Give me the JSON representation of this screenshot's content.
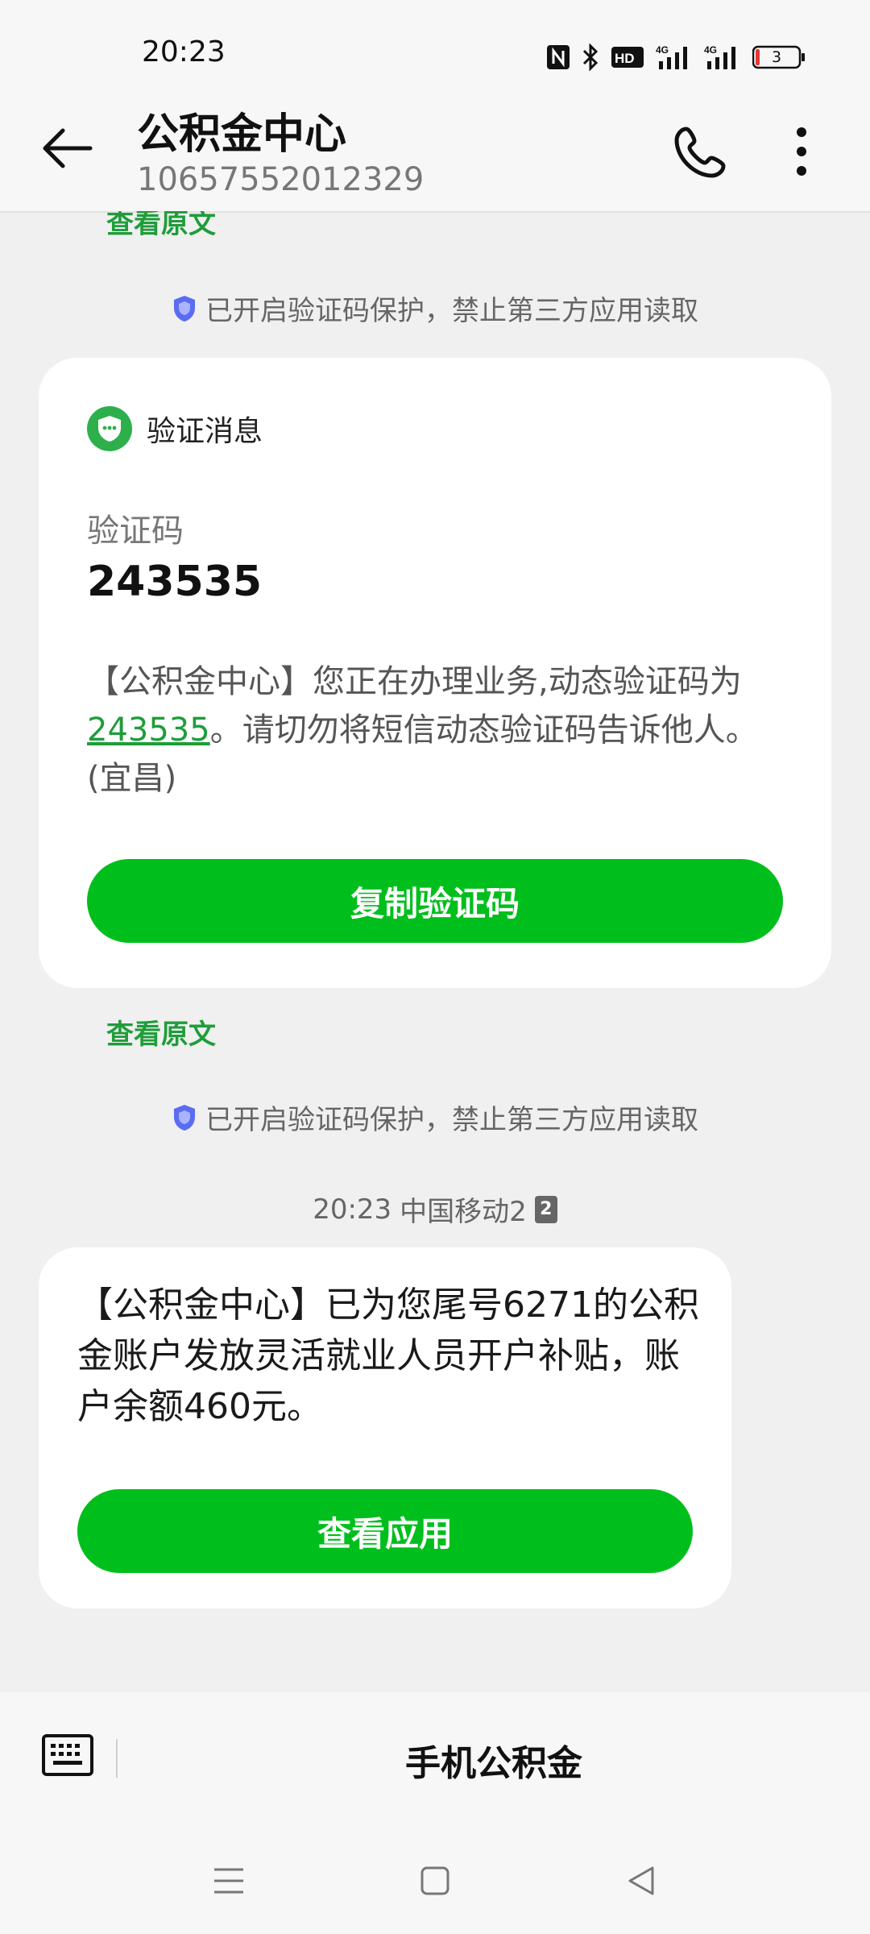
{
  "status_bar": {
    "time": "20:23",
    "battery": "3",
    "icons": [
      "nfc-icon",
      "bluetooth-icon",
      "hd-icon",
      "signal-4g-icon",
      "signal-4g-icon",
      "battery-icon"
    ]
  },
  "header": {
    "title": "公积金中心",
    "number": "10657552012329"
  },
  "top_partial_link": "查看原文",
  "protection_notice": "已开启验证码保护，禁止第三方应用读取",
  "verify_card": {
    "badge_label": "验证消息",
    "code_label": "验证码",
    "code_value": "243535",
    "message_prefix": "【公积金中心】您正在办理业务,动态验证码为",
    "message_code": "243535",
    "message_suffix": "。请切勿将短信动态验证码告诉他人。(宜昌)",
    "copy_button": "复制验证码"
  },
  "view_original": "查看原文",
  "protection_notice_2": "已开启验证码保护，禁止第三方应用读取",
  "message_meta": {
    "time": "20:23",
    "carrier": "中国移动2",
    "sim": "2"
  },
  "balance_card": {
    "text": "【公积金中心】已为您尾号6271的公积金账户发放灵活就业人员开户补贴，账户余额460元。",
    "button": "查看应用"
  },
  "bottom_bar": {
    "menu_title": "手机公积金"
  },
  "colors": {
    "accent_green": "#00bf1c",
    "link_green": "#1f9d3a",
    "shield_blue": "#5b6cf0"
  }
}
